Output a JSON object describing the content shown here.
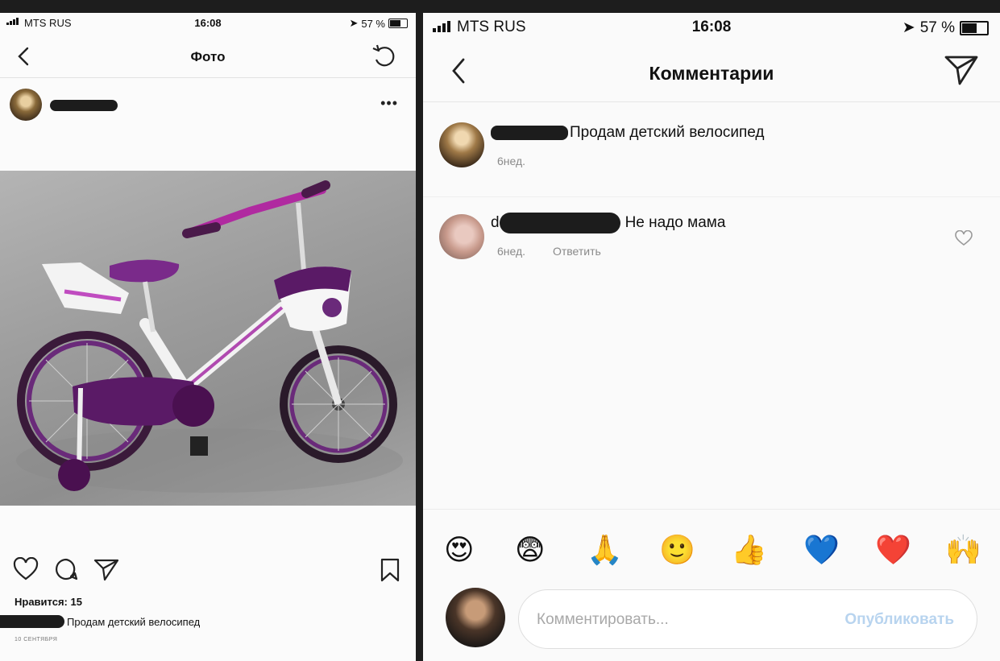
{
  "left_screen": {
    "status": {
      "carrier": "MTS RUS",
      "time": "16:08",
      "battery": "57 %",
      "battery_level": 0.57
    },
    "nav": {
      "title": "Фото"
    },
    "post": {
      "likes": "Нравится: 15",
      "caption": "Продам детский велосипед",
      "date": "10 СЕНТЯБРЯ"
    }
  },
  "right_screen": {
    "status": {
      "carrier": "MTS RUS",
      "time": "16:08",
      "battery": "57 %",
      "battery_level": 0.57
    },
    "nav": {
      "title": "Комментарии"
    },
    "comments": [
      {
        "text": "Продам детский велосипед",
        "time": "6нед.",
        "reply": ""
      },
      {
        "prefix": "d",
        "text": "Не надо мама",
        "time": "6нед.",
        "reply": "Ответить"
      }
    ],
    "emojis": [
      "😍",
      "😨",
      "🙏",
      "🙂",
      "👍",
      "💙",
      "❤️",
      "🙌"
    ],
    "composer": {
      "placeholder": "Комментировать...",
      "publish": "Опубликовать"
    }
  },
  "colors": {
    "accent_disabled": "#b8d4ef",
    "text": "#111111",
    "meta": "#8a8a8a"
  }
}
